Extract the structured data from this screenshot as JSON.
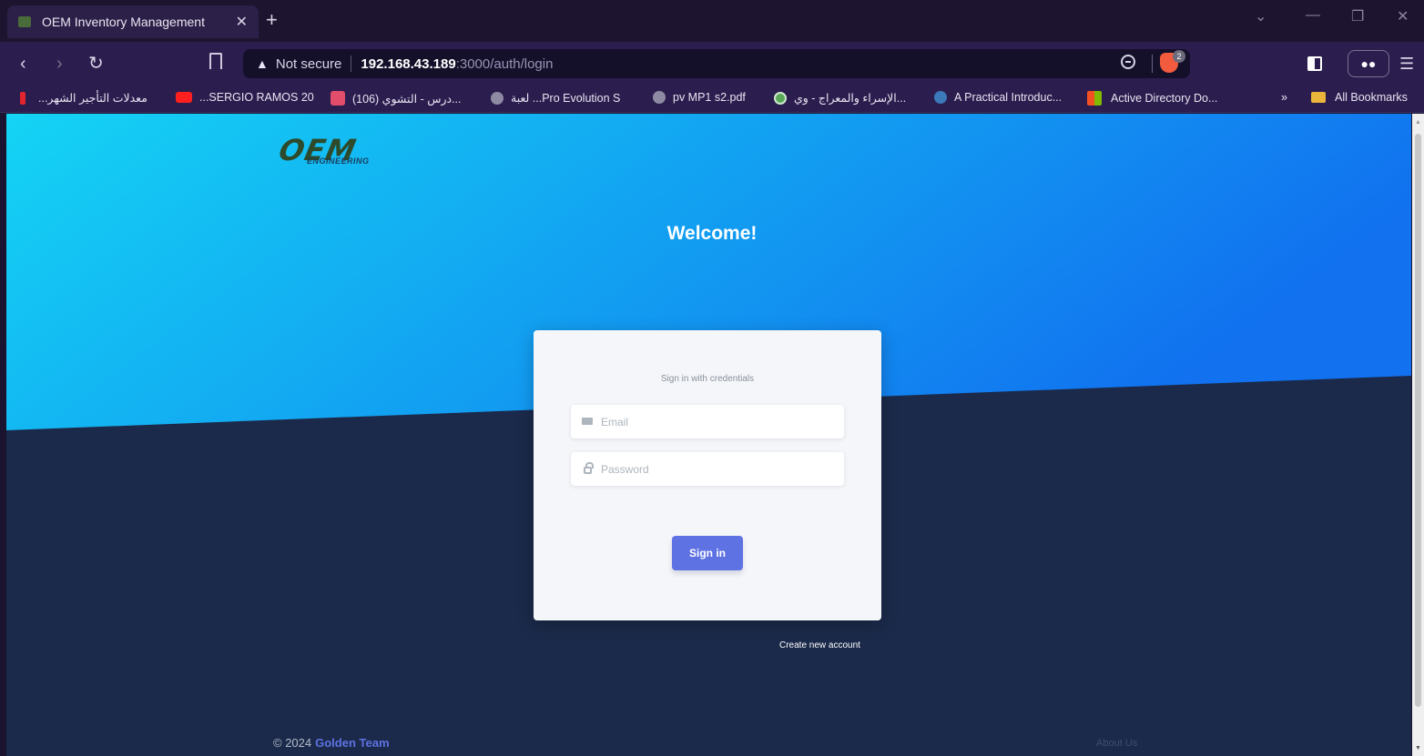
{
  "browser": {
    "tab_title": "OEM Inventory Management",
    "tab_close": "✕",
    "new_tab": "+",
    "url_warning": "Not secure",
    "url_host": "192.168.43.189",
    "url_path": ":3000/auth/login",
    "shields_count": "2"
  },
  "bookmarks": {
    "items": [
      "...معدلات التأجير الشهر",
      "...SERGIO RAMOS 20",
      "(106) درس - التشوي...",
      "لعبة ...Pro Evolution S",
      "pv MP1 s2.pdf",
      "الإسراء والمعراج - وي...",
      "A Practical Introduc...",
      "Active Directory Do..."
    ],
    "overflow": "»",
    "all_bookmarks": "All Bookmarks"
  },
  "page": {
    "logo_main": "OEM",
    "logo_sub": "ENGINEERING",
    "welcome": "Welcome!",
    "card": {
      "subtitle": "Sign in with credentials",
      "email_placeholder": "Email",
      "password_placeholder": "Password",
      "signin_label": "Sign in"
    },
    "create_account": "Create new account",
    "copyright": "© 2024",
    "team": "Golden Team",
    "about": "About Us"
  },
  "colors": {
    "primary": "#5e72e4",
    "hero_start": "#14d4f4",
    "hero_end": "#1171ef",
    "page_bg": "#1b2a4a"
  }
}
